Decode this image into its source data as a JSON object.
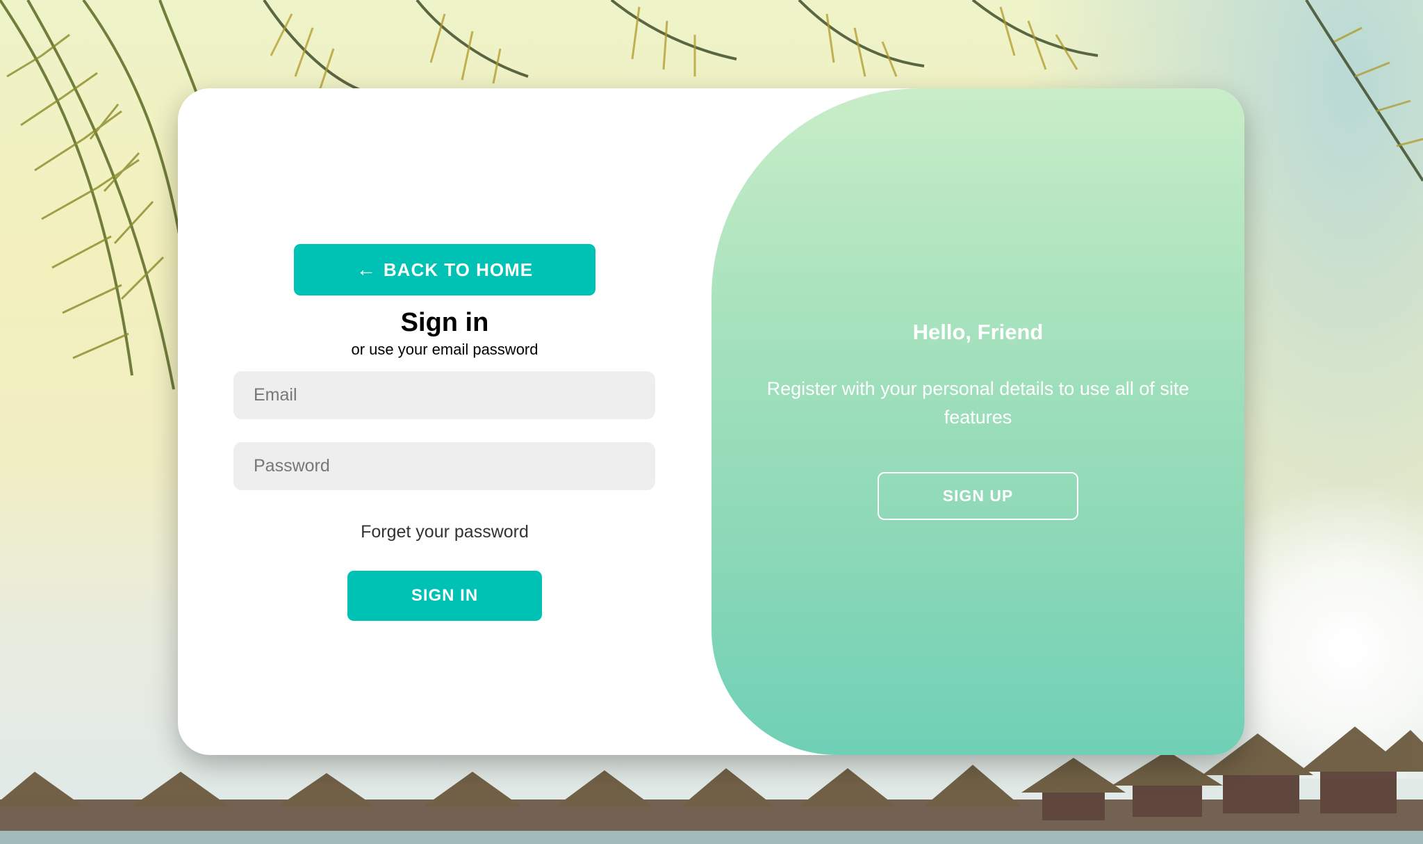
{
  "background": {
    "description_icons": [
      "palm-leaves",
      "beach-huts"
    ]
  },
  "sign_in": {
    "back_button": {
      "icon": "arrow-left-icon",
      "arrow_glyph": "←",
      "label": "BACK TO HOME"
    },
    "title": "Sign in",
    "subtitle": "or use your email password",
    "email_placeholder": "Email",
    "password_placeholder": "Password",
    "forgot_label": "Forget your password",
    "submit_label": "SIGN IN"
  },
  "sign_up_panel": {
    "title": "Hello, Friend",
    "text": "Register with your personal details to use all of site features",
    "button_label": "SIGN UP"
  },
  "colors": {
    "accent": "#00c2b4",
    "panel_top": "#c9edc8",
    "panel_bottom": "#6fd0b5"
  }
}
